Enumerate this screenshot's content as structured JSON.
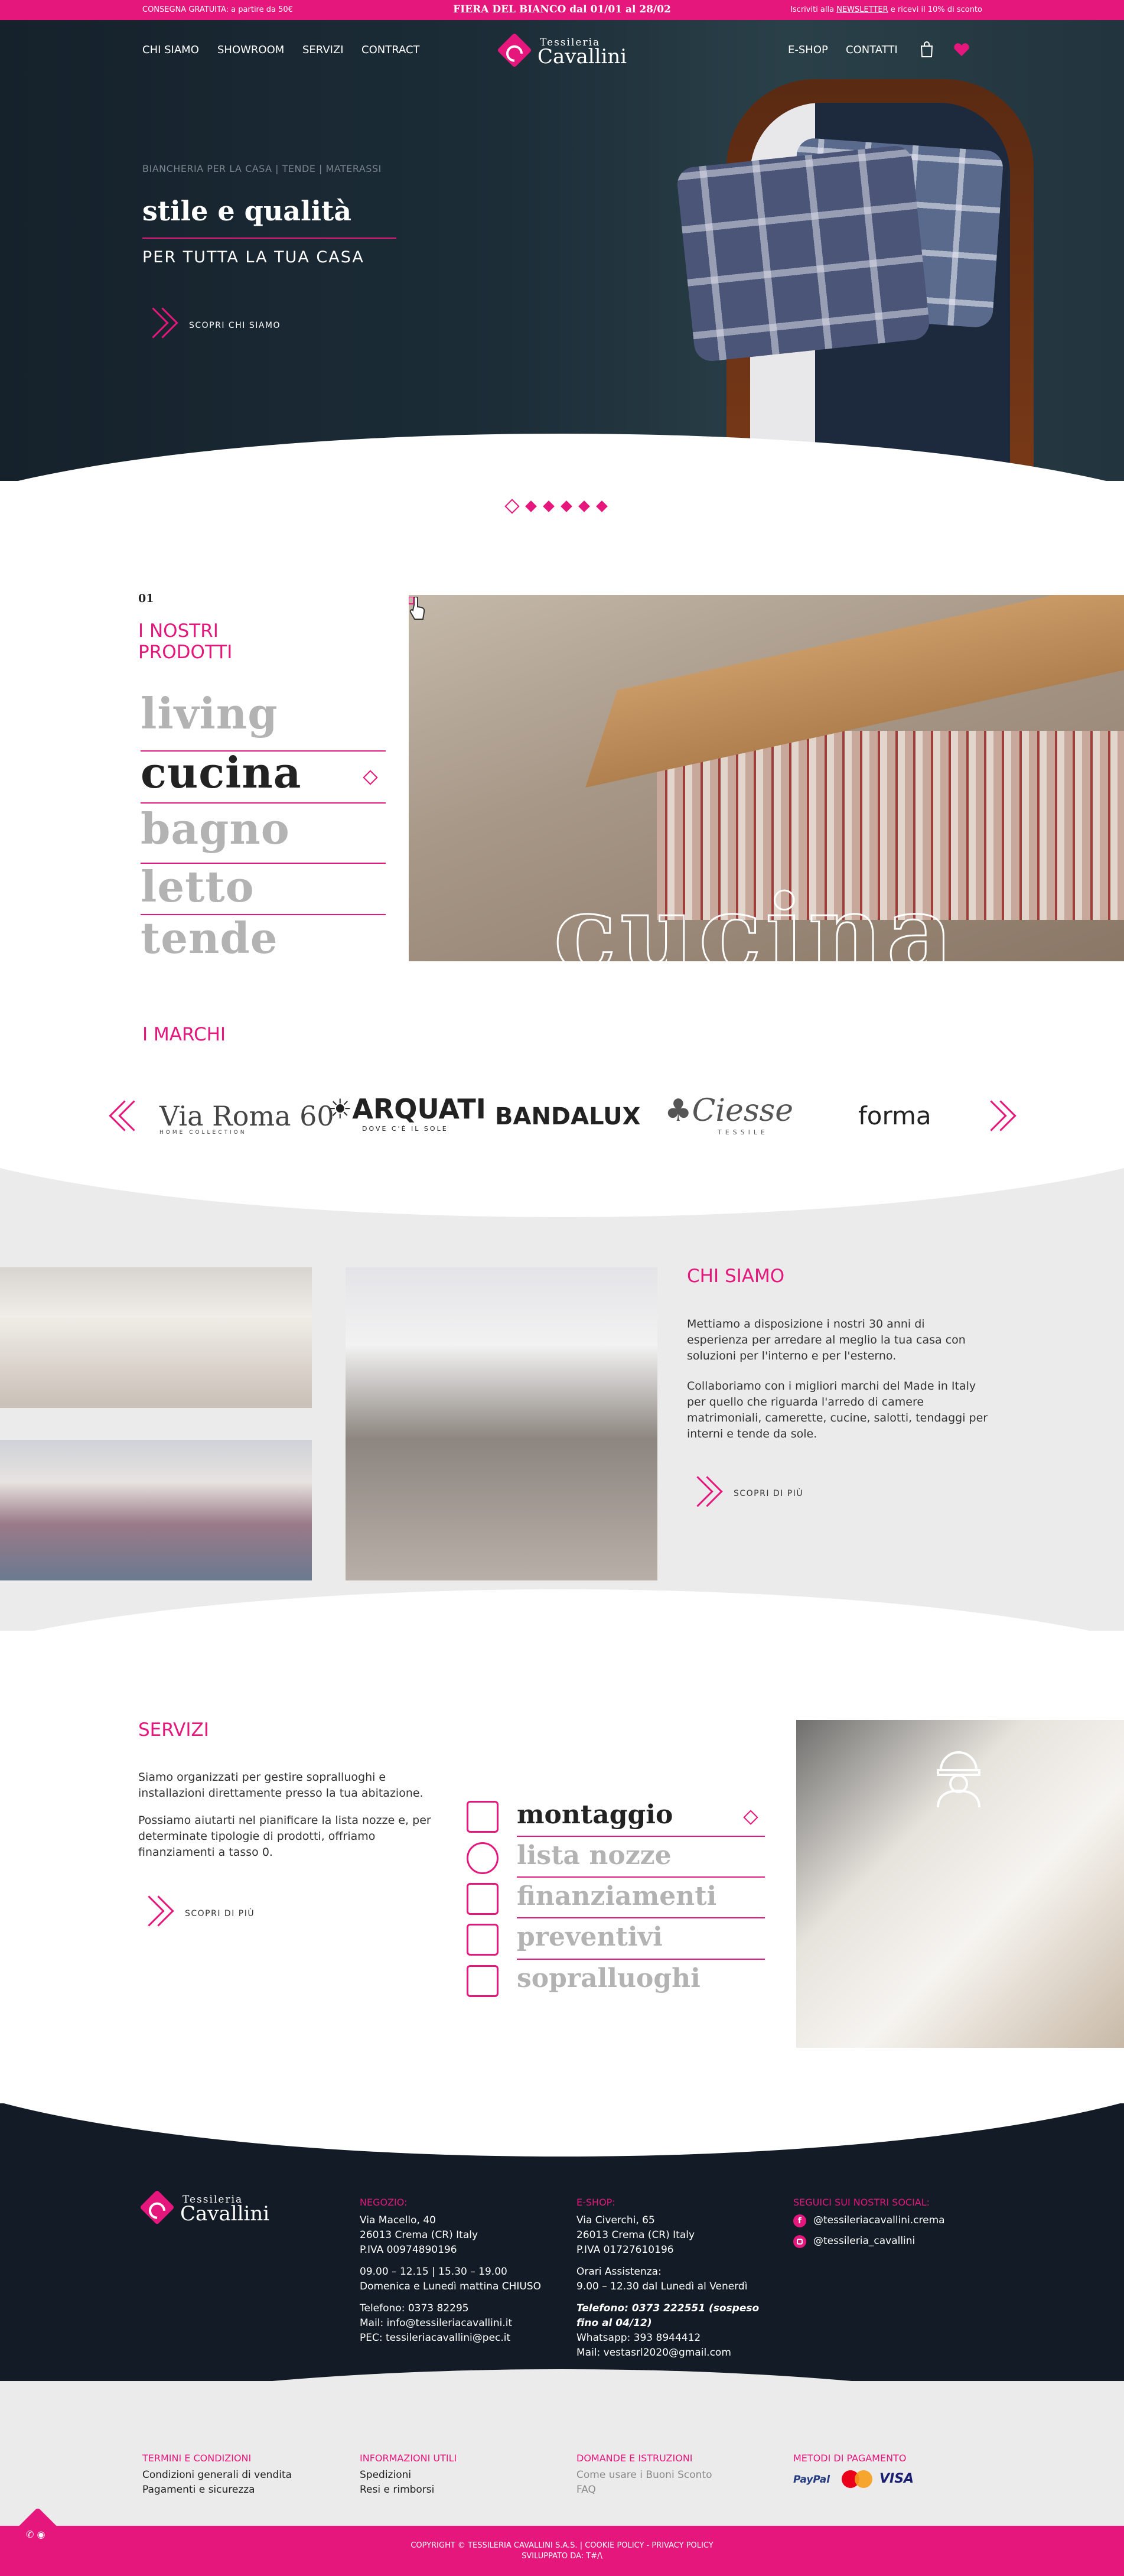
{
  "topbar": {
    "left": "CONSEGNA GRATUITA: a partire da 50€",
    "center": "FIERA DEL BIANCO dal 01/01 al 28/02",
    "right_a": "Iscriviti alla ",
    "right_link": "NEWSLETTER",
    "right_b": " e ricevi il 10% di sconto"
  },
  "nav": {
    "left": [
      "CHI SIAMO",
      "SHOWROOM",
      "SERVIZI",
      "CONTRACT"
    ],
    "right": [
      "E-SHOP",
      "CONTATTI"
    ]
  },
  "logo": {
    "line1": "Tessileria",
    "line2": "Cavallini"
  },
  "hero": {
    "kicker": "BIANCHERIA PER LA CASA | TENDE | MATERASSI",
    "title": "stile e qualità",
    "subtitle": "PER TUTTA LA TUA CASA",
    "cta": "SCOPRI CHI SIAMO"
  },
  "prodotti": {
    "number": "01",
    "heading_l1": "I NOSTRI",
    "heading_l2": "PRODOTTI",
    "categories": [
      "living",
      "cucina",
      "bagno",
      "letto",
      "tende"
    ],
    "active": "cucina",
    "image_word": "cucina"
  },
  "marchi": {
    "heading": "I MARCHI",
    "brands": [
      "Via Roma 60",
      "ARQUATI",
      "BANDALUX",
      "Ciesse",
      "forma"
    ],
    "roma_tag": "HOME COLLECTION",
    "arquati_tag": "DOVE C'È IL SOLE",
    "ciesse_tag": "TESSILE"
  },
  "chisiamo": {
    "heading": "CHI SIAMO",
    "p1": "Mettiamo a disposizione i nostri 30 anni di esperienza per arredare al meglio la tua casa con soluzioni per l'interno e per l'esterno.",
    "p2": "Collaboriamo con i migliori marchi del Made in Italy per quello che riguarda l'arredo di camere matrimoniali, camerette, cucine, salotti, tendaggi per interni e tende da sole.",
    "cta": "SCOPRI DI PIÙ"
  },
  "servizi": {
    "heading": "SERVIZI",
    "p1": "Siamo organizzati per gestire sopralluoghi e installazioni direttamente presso la tua abitazione.",
    "p2": "Possiamo aiutarti nel pianificare la lista nozze e, per determinate tipologie di prodotti, offriamo finanziamenti a tasso 0.",
    "cta": "SCOPRI DI PIÙ",
    "items": [
      "montaggio",
      "lista nozze",
      "finanziamenti",
      "preventivi",
      "sopralluoghi"
    ],
    "active": "montaggio"
  },
  "footer": {
    "negozio": {
      "title": "NEGOZIO:",
      "addr1": "Via Macello, 40",
      "addr2": "26013 Crema (CR) Italy",
      "piva": "P.IVA 00974890196",
      "hours1": "09.00 – 12.15 | 15.30 – 19.00",
      "hours2": "Domenica e Lunedì mattina CHIUSO",
      "tel": "Telefono: 0373 82295",
      "mail": "Mail: info@tessileriacavallini.it",
      "pec": "PEC: tessileriacavallini@pec.it"
    },
    "eshop": {
      "title": "E-SHOP:",
      "addr1": "Via Civerchi, 65",
      "addr2": "26013 Crema (CR) Italy",
      "piva": "P.IVA 01727610196",
      "assist": "Orari Assistenza:",
      "hours": "9.00 – 12.30 dal Lunedì al Venerdì",
      "tel": "Telefono: 0373 222551 (sospeso fino al 04/12)",
      "whatsapp": "Whatsapp: 393 8944412",
      "mail": "Mail: vestasrl2020@gmail.com"
    },
    "social": {
      "title": "SEGUICI SUI NOSTRI SOCIAL:",
      "fb": "@tessileriacavallini.crema",
      "ig": "@tessileria_cavallini"
    }
  },
  "links": {
    "termini": {
      "title": "TERMINI E CONDIZIONI",
      "a": "Condizioni generali di vendita",
      "b": "Pagamenti e sicurezza"
    },
    "info": {
      "title": "INFORMAZIONI UTILI",
      "a": "Spedizioni",
      "b": "Resi e rimborsi"
    },
    "domande": {
      "title": "DOMANDE E ISTRUZIONI",
      "a": "Come usare i Buoni Sconto",
      "b": "FAQ"
    },
    "pagamento": {
      "title": "METODI DI PAGAMENTO",
      "paypal": "PayPal",
      "mc": "mastercard",
      "visa": "VISA"
    }
  },
  "bottom": {
    "copy": "COPYRIGHT © TESSILERIA CAVALLINI S.A.S. | COOKIE POLICY - PRIVACY POLICY",
    "dev": "SVILUPPATO DA: T#/\\"
  },
  "colors": {
    "accent": "#e5177c",
    "dark": "#131c26",
    "band": "#ebebeb"
  }
}
